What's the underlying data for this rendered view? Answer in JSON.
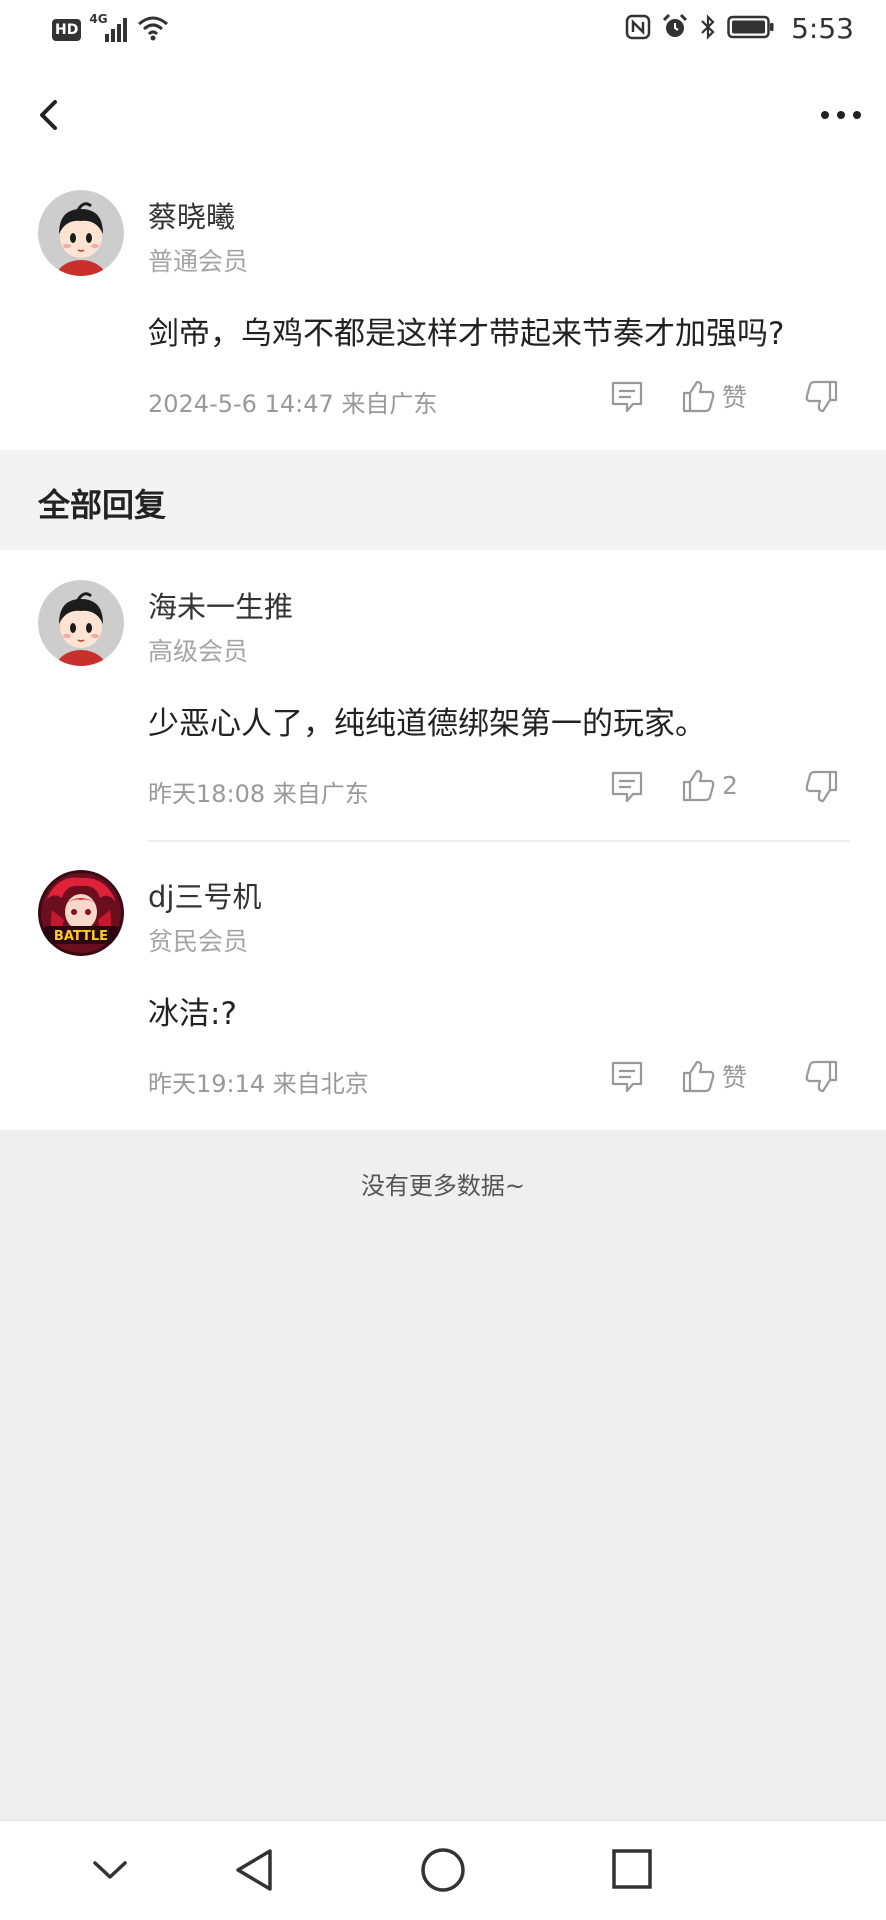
{
  "status_bar": {
    "hd": "HD",
    "network": "4G",
    "time": "5:53"
  },
  "main_comment": {
    "username": "蔡晓曦",
    "level": "普通会员",
    "text": "剑帝，乌鸡不都是这样才带起来节奏才加强吗?",
    "meta": "2024-5-6 14:47  来自广东",
    "like_label": "赞"
  },
  "section": {
    "title": "全部回复"
  },
  "replies": [
    {
      "username": "海未一生推",
      "level": "高级会员",
      "text": "少恶心人了，纯纯道德绑架第一的玩家。",
      "meta": "昨天18:08 来自广东",
      "like_label": "2"
    },
    {
      "username": "dj三号机",
      "level": "贫民会员",
      "text": "冰洁:?",
      "meta": "昨天19:14 来自北京",
      "like_label": "赞",
      "avatar_text": "BATTLE"
    }
  ],
  "footer": {
    "no_more": "没有更多数据~"
  },
  "colors": {
    "accent_red": "#d22f2f",
    "meta_gray": "#999999",
    "bg": "#efefef"
  },
  "icons": [
    "back-icon",
    "more-icon",
    "comment-icon",
    "thumbs-up-icon",
    "thumbs-down-icon",
    "nav-down-icon",
    "nav-back-icon",
    "nav-home-icon",
    "nav-recents-icon"
  ]
}
